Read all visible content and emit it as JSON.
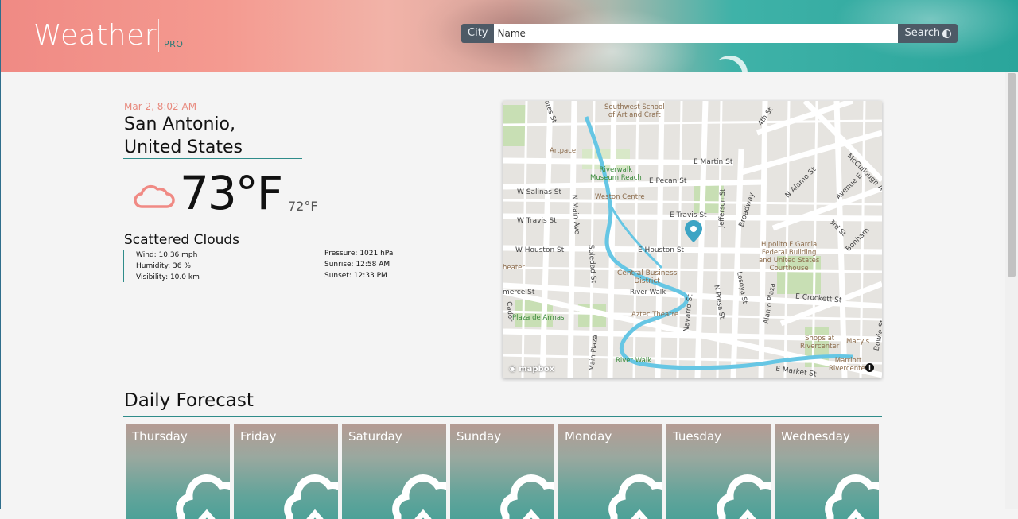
{
  "header": {
    "title": "Weather",
    "title_suffix": "PRO",
    "search": {
      "label": "City",
      "placeholder": "Name",
      "button_label": "Search",
      "theme_icon": "contrast-icon"
    }
  },
  "current": {
    "datetime": "Mar 2, 8:02 AM",
    "city_line1": "San Antonio,",
    "city_line2": "United States",
    "icon": "cloud-icon",
    "temperature": "73°F",
    "feels_like": "72°F",
    "condition": "Scattered Clouds",
    "details_left": [
      "Wind: 10.36 mph",
      "Humidity: 36 %",
      "Visibility: 10.0 km"
    ],
    "details_right": [
      "Pressure: 1021 hPa",
      "Sunrise: 12:58 AM",
      "Sunset: 12:33 PM"
    ]
  },
  "map": {
    "attribution": "mapbox",
    "marker_icon": "map-pin-icon",
    "labels": {
      "southwest_school": "Southwest School\nof Art and Craft",
      "artpace": "Artpace",
      "riverwalk_museum": "Riverwalk\nMuseum Reach",
      "weston": "Weston Centre",
      "e_martin": "E Martin St",
      "e_pecan": "E Pecan St",
      "w_salinas": "W Salinas St",
      "n_main": "N Main Ave",
      "w_travis": "W Travis St",
      "e_travis": "E Travis St",
      "jefferson": "Jefferson St",
      "broadway": "Broadway",
      "n_alamo": "N Alamo St",
      "avenue_e": "Avenue E",
      "mccullough": "McCullough A",
      "third": "3rd St",
      "bonham": "Bonham",
      "fourth": "4th St",
      "flores": "Flores St",
      "w_houston": "W Houston St",
      "e_houston": "E Houston St",
      "soledad": "Soledad St",
      "hipolito": "Hipolito F Garcia\nFederal Building\nand United States\nCourthouse",
      "theater": "heater",
      "cbd": "Central Business\nDistrict",
      "river_walk1": "River Walk",
      "aztec": "Aztec Theatre",
      "commerce": "merce St",
      "cadoor": "Cador",
      "plaza": "Plaza de Armas",
      "navarro": "Navarro St",
      "presa": "N Presa St",
      "losoya": "Losoya St",
      "alamo_plaza": "Alamo Plaza",
      "e_crockett": "E Crockett St",
      "shops": "Shops at\nRivercenter",
      "macys": "Macy's",
      "main_plaza": "Main Plaza",
      "river_walk2": "River Walk",
      "marriott": "Marriott\nRivercenter",
      "e_market": "E Market St",
      "bowie": "Bowie St"
    }
  },
  "forecast": {
    "title": "Daily Forecast",
    "days": [
      {
        "day": "Thursday",
        "icon": "cloud-icon"
      },
      {
        "day": "Friday",
        "icon": "cloud-icon"
      },
      {
        "day": "Saturday",
        "icon": "cloud-icon"
      },
      {
        "day": "Sunday",
        "icon": "cloud-icon"
      },
      {
        "day": "Monday",
        "icon": "cloud-icon"
      },
      {
        "day": "Tuesday",
        "icon": "cloud-icon"
      },
      {
        "day": "Wednesday",
        "icon": "cloud-icon"
      }
    ]
  },
  "colors": {
    "accent": "#2f8c8a",
    "date": "#e88a7e",
    "cloud_icon": "#f08a84",
    "search_bar": "#4d5a66",
    "map_pin": "#3ca4c4"
  }
}
